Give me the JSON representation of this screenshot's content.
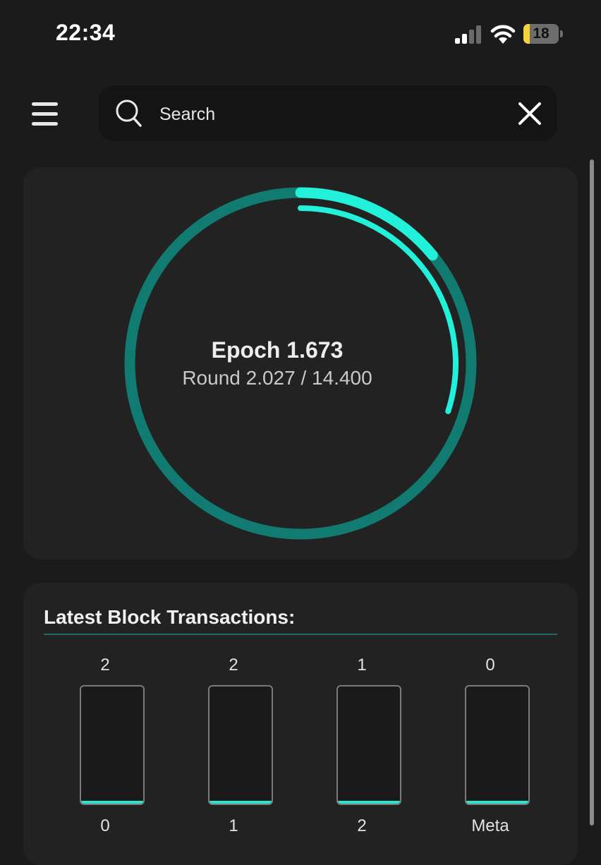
{
  "status_bar": {
    "time": "22:34",
    "battery_level": "18",
    "battery_fraction": 0.18,
    "battery_color": "#f5d33a",
    "signal_bars_active": 2,
    "icons": [
      "signal-icon",
      "wifi-icon",
      "battery-icon"
    ]
  },
  "header": {
    "menu_icon": "hamburger-menu-icon",
    "search": {
      "placeholder": "Search",
      "value": "",
      "search_icon": "search-icon",
      "clear_icon": "close-icon"
    }
  },
  "epoch": {
    "title": "Epoch 1.673",
    "round_text": "Round 2.027 / 14.400",
    "round_progress": 0.1408,
    "inner_progress": 0.3,
    "colors": {
      "track": "#127b71",
      "progress": "#23f0d8"
    }
  },
  "transactions": {
    "title": "Latest Block Transactions:",
    "fill_color": "#2ae6cf",
    "shards": [
      {
        "count": "2",
        "label": "0",
        "fill": 0.02
      },
      {
        "count": "2",
        "label": "1",
        "fill": 0.02
      },
      {
        "count": "1",
        "label": "2",
        "fill": 0.01
      },
      {
        "count": "0",
        "label": "Meta",
        "fill": 0.01
      }
    ]
  }
}
